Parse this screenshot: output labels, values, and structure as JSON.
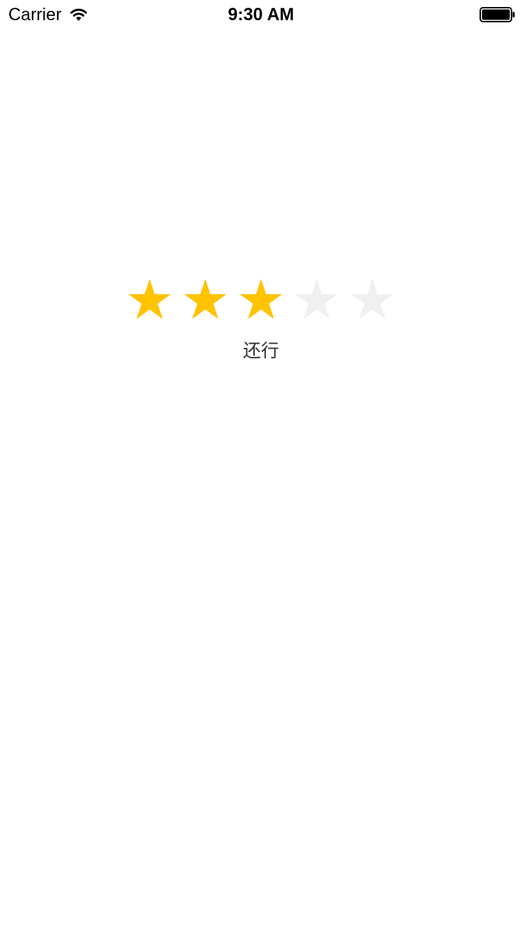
{
  "status_bar": {
    "carrier": "Carrier",
    "time": "9:30 AM",
    "signal_icon": "wifi-icon",
    "battery_icon": "battery-icon"
  },
  "rating": {
    "value": 3,
    "max": 5,
    "label": "还行",
    "filled_color": "#FFC300",
    "empty_color": "#F0F0F0",
    "star_icon": "star-icon"
  }
}
